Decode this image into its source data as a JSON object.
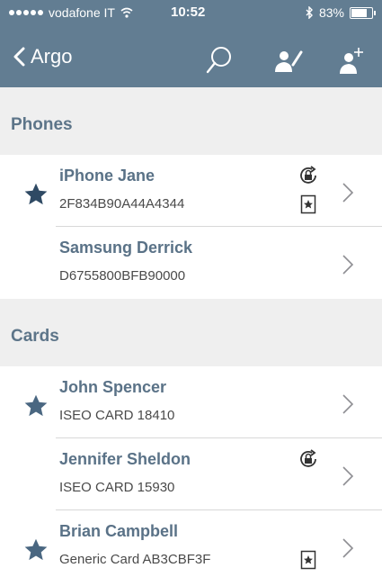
{
  "status_bar": {
    "carrier": "vodafone IT",
    "time": "10:52",
    "battery_percent": "83%",
    "battery_level": 0.83
  },
  "nav": {
    "back_label": "Argo",
    "icons": [
      "search-icon",
      "edit-user-icon",
      "add-user-icon"
    ]
  },
  "sections": {
    "phones": {
      "title": "Phones",
      "items": [
        {
          "name": "iPhone Jane",
          "id": "2F834B90A44A4344",
          "starred": true,
          "lock": true,
          "badge": true
        },
        {
          "name": "Samsung Derrick",
          "id": "D6755800BFB90000",
          "starred": false,
          "lock": false,
          "badge": false
        }
      ]
    },
    "cards": {
      "title": "Cards",
      "items": [
        {
          "name": "John Spencer",
          "id": "ISEO CARD 18410",
          "starred": true,
          "lock": false,
          "badge": false
        },
        {
          "name": "Jennifer Sheldon",
          "id": "ISEO CARD 15930",
          "starred": false,
          "lock": true,
          "badge": false
        },
        {
          "name": "Brian Campbell",
          "id": "Generic Card AB3CBF3F",
          "starred": true,
          "lock": false,
          "badge": true
        }
      ]
    }
  },
  "colors": {
    "nav_background": "#627d92",
    "accent": "#5a7287",
    "section_background": "#efefef"
  }
}
